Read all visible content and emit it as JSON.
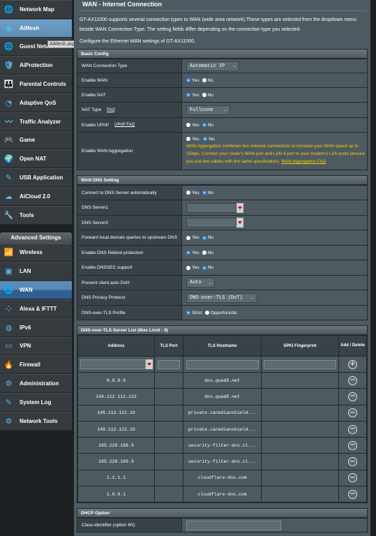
{
  "sidebar": {
    "items": [
      {
        "label": "Network Map",
        "icon": "network-map-icon"
      },
      {
        "label": "AiMesh",
        "icon": "aimesh-icon",
        "active": true
      },
      {
        "label": "Guest Network",
        "icon": "guest-network-icon"
      },
      {
        "label": "AiProtection",
        "icon": "aiprotection-icon"
      },
      {
        "label": "Parental Controls",
        "icon": "parental-controls-icon"
      },
      {
        "label": "Adaptive QoS",
        "icon": "adaptive-qos-icon"
      },
      {
        "label": "Traffic Analyzer",
        "icon": "traffic-analyzer-icon"
      },
      {
        "label": "Game",
        "icon": "game-icon"
      },
      {
        "label": "Open NAT",
        "icon": "open-nat-icon"
      },
      {
        "label": "USB Application",
        "icon": "usb-application-icon"
      },
      {
        "label": "AiCloud 2.0",
        "icon": "aicloud-icon"
      },
      {
        "label": "Tools",
        "icon": "tools-icon"
      }
    ],
    "advanced_header": "Advanced Settings",
    "advanced_items": [
      {
        "label": "Wireless",
        "icon": "wireless-icon"
      },
      {
        "label": "LAN",
        "icon": "lan-icon"
      },
      {
        "label": "WAN",
        "icon": "wan-icon",
        "active": true
      },
      {
        "label": "Alexa & IFTTT",
        "icon": "alexa-icon"
      },
      {
        "label": "IPv6",
        "icon": "ipv6-icon"
      },
      {
        "label": "VPN",
        "icon": "vpn-icon"
      },
      {
        "label": "Firewall",
        "icon": "firewall-icon"
      },
      {
        "label": "Administration",
        "icon": "administration-icon"
      },
      {
        "label": "System Log",
        "icon": "system-log-icon"
      },
      {
        "label": "Network Tools",
        "icon": "network-tools-icon"
      }
    ],
    "tooltip": "AiMesh.asp"
  },
  "page": {
    "title": "WAN - Internet Connection",
    "description": "GT-AX11000 supports several connection types to WAN (wide area network).These types are selected from the dropdown menu beside WAN Connection Type. The setting fields differ depending on the connection type you selected.",
    "configure_note": "Configure the Ethernet WAN settings of GT-AX11000."
  },
  "basic": {
    "header": "Basic Config",
    "wan_type_label": "WAN Connection Type",
    "wan_type_value": "Automatic IP",
    "enable_wan_label": "Enable WAN",
    "enable_nat_label": "Enable NAT",
    "nat_type_label": "NAT Type",
    "nat_faq": "FAQ",
    "nat_type_value": "Fullcone",
    "upnp_label": "Enable UPnP",
    "upnp_faq": "UPnP  FAQ",
    "aggregation_label": "Enable WAN Aggregation",
    "aggregation_warning": "WAN Aggregation combines two network connections to increase your WAN speed up to 2Gbps. Connect your router's WAN port and LAN 4 port to your modem's LAN ports (ensure you use two cables with the same specification). ",
    "aggregation_faq": "WAN Aggregation FAQ",
    "yes": "Yes",
    "no": "No"
  },
  "dns": {
    "header": "WAN DNS Setting",
    "auto_label": "Connect to DNS Server automatically",
    "dns1_label": "DNS Server1",
    "dns2_label": "DNS Server2",
    "forward_label": "Forward local domain queries to upstream DNS",
    "rebind_label": "Enable DNS Rebind protection",
    "dnssec_label": "Enable DNSSEC support",
    "doh_label": "Prevent client auto DoH",
    "doh_value": "Auto",
    "privacy_label": "DNS Privacy Protocol",
    "privacy_value": "DNS-over-TLS (DoT)",
    "profile_label": "DNS-over-TLS Profile",
    "strict": "Strict",
    "opportunistic": "Opportunistic"
  },
  "dot": {
    "header": "DNS-over-TLS Server List (Max Limit : 8)",
    "columns": [
      "Address",
      "TLS Port",
      "TLS Hostname",
      "SPKI Fingerprint",
      "Add / Delete"
    ],
    "rows": [
      {
        "address": "9.9.9.9",
        "port": "",
        "hostname": "dns.quad9.net",
        "spki": ""
      },
      {
        "address": "149.112.112.112",
        "port": "",
        "hostname": "dns.quad9.net",
        "spki": ""
      },
      {
        "address": "149.112.121.10",
        "port": "",
        "hostname": "private.canadianshield...",
        "spki": ""
      },
      {
        "address": "149.112.122.10",
        "port": "",
        "hostname": "private.canadianshield...",
        "spki": ""
      },
      {
        "address": "185.228.168.9",
        "port": "",
        "hostname": "security-filter-dns.cl...",
        "spki": ""
      },
      {
        "address": "185.228.169.9",
        "port": "",
        "hostname": "security-filter-dns.cl...",
        "spki": ""
      },
      {
        "address": "1.1.1.1",
        "port": "",
        "hostname": "cloudflare-dns.com",
        "spki": ""
      },
      {
        "address": "1.0.0.1",
        "port": "",
        "hostname": "cloudflare-dns.com",
        "spki": ""
      }
    ]
  },
  "dhcp": {
    "header": "DHCP Option",
    "class_id_label": "Class-identifier (option 60):"
  }
}
